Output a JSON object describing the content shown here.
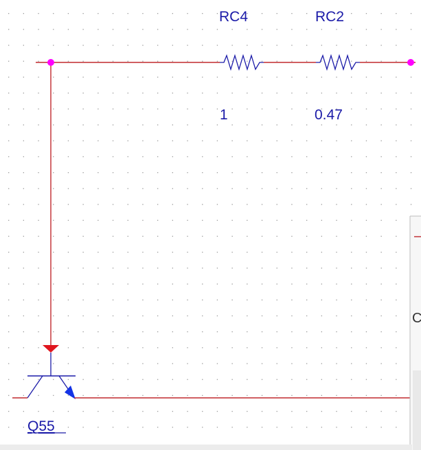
{
  "schematic": {
    "resistors": [
      {
        "ref": "RC4",
        "value": "1"
      },
      {
        "ref": "RC2",
        "value": "0.47"
      }
    ],
    "transistor": {
      "ref": "Q55"
    },
    "side_panel": {
      "partial_text": "C"
    }
  },
  "colors": {
    "wire": "#c0282d",
    "net_node": "#ff00ff",
    "component": "#1a1aa8",
    "arrow": "#1433e6",
    "grid_dot": "#9a9a9a"
  }
}
